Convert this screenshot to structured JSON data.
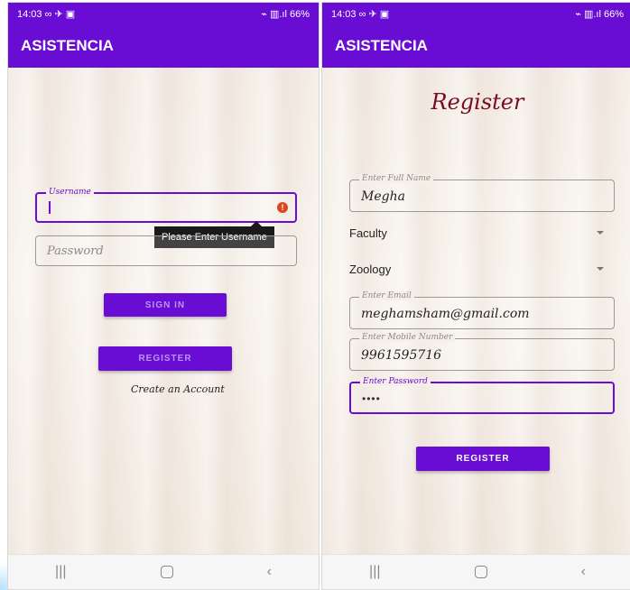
{
  "left": {
    "status": {
      "time": "14:03",
      "left_icons": "∞ ✈ ▣",
      "right_text": "⌁ ▥.ıl 66%",
      "battery_icon": "battery-icon"
    },
    "app_bar_title": "ASISTENCIA",
    "username": {
      "label": "Username",
      "value": ""
    },
    "password": {
      "placeholder": "Password"
    },
    "tooltip": "Please Enter Username",
    "sign_in_label": "SIGN IN",
    "register_label": "REGISTER",
    "create_account": "Create an Account"
  },
  "right": {
    "status": {
      "time": "14:03",
      "left_icons": "∞ ✈ ▣",
      "right_text": "⌁ ▥.ıl 66%",
      "battery_icon": "battery-icon"
    },
    "app_bar_title": "ASISTENCIA",
    "title": "Register",
    "full_name": {
      "label": "Enter Full Name",
      "value": "Megha"
    },
    "role_select": {
      "value": "Faculty"
    },
    "department_select": {
      "value": "Zoology"
    },
    "email": {
      "label": "Enter Email",
      "value": "meghamsham@gmail.com"
    },
    "mobile": {
      "label": "Enter Mobile Number",
      "value": "9961595716"
    },
    "password": {
      "label": "Enter Password",
      "value": "••••"
    },
    "register_label": "REGISTER"
  },
  "nav": {
    "recents": "|||",
    "home": "home-icon",
    "back": "‹"
  },
  "colors": {
    "primary": "#6a0dd4",
    "title": "#7a0c20",
    "error": "#d9481c",
    "tooltip_bg": "#1a1a1a"
  }
}
